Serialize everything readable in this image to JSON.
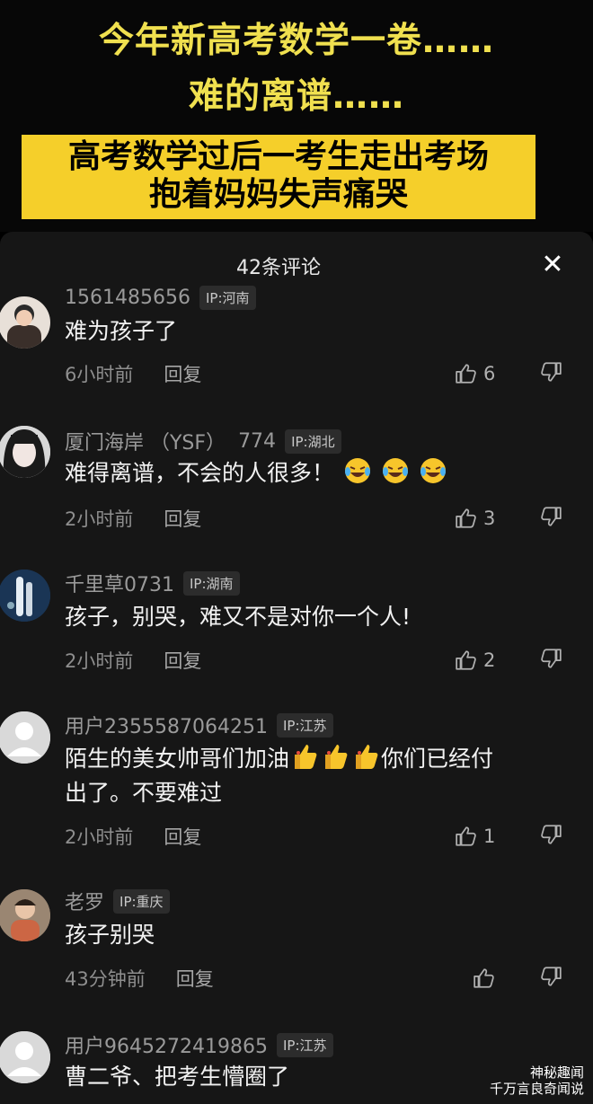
{
  "video": {
    "headline_line1": "今年新高考数学一卷……",
    "headline_line2": "难的离谱……",
    "banner_line1": "高考数学过后一考生走出考场",
    "banner_line2": "抱着妈妈失声痛哭"
  },
  "panel": {
    "title": "42条评论",
    "close_icon": "close-icon"
  },
  "reply_label": "回复",
  "comments": [
    {
      "user": "1561485656",
      "score": "",
      "ip": "IP:河南",
      "text": "难为孩子了",
      "time": "6小时前",
      "likes": "6",
      "emoji_count": 0,
      "thumbs_count": 0,
      "suffix": ""
    },
    {
      "user": "厦门海岸 （YSF）",
      "score": "774",
      "ip": "IP:湖北",
      "text": "难得离谱，不会的人很多！",
      "time": "2小时前",
      "likes": "3",
      "emoji_count": 3,
      "thumbs_count": 0,
      "suffix": ""
    },
    {
      "user": "千里草0731",
      "score": "",
      "ip": "IP:湖南",
      "text": "孩子，别哭，难又不是对你一个人!",
      "time": "2小时前",
      "likes": "2",
      "emoji_count": 0,
      "thumbs_count": 0,
      "suffix": ""
    },
    {
      "user": "用户2355587064251",
      "score": "",
      "ip": "IP:江苏",
      "text": "陌生的美女帅哥们加油",
      "text_suffix": "你们已经付",
      "text_line2": "出了。不要难过",
      "time": "2小时前",
      "likes": "1",
      "emoji_count": 0,
      "thumbs_count": 3
    },
    {
      "user": "老罗",
      "score": "",
      "ip": "IP:重庆",
      "text": "孩子别哭",
      "time": "43分钟前",
      "likes": "",
      "emoji_count": 0,
      "thumbs_count": 0,
      "suffix": ""
    },
    {
      "user": "用户9645272419865",
      "score": "",
      "ip": "IP:江苏",
      "text": "曹二爷、把考生懵圈了",
      "time": "",
      "likes": "",
      "emoji_count": 0,
      "thumbs_count": 0,
      "suffix": ""
    }
  ],
  "watermark": {
    "line1": "神秘趣闻",
    "line2": "千万言良奇闻说"
  },
  "colors": {
    "banner": "#f5cf2a",
    "headline": "#f0e04f",
    "panel": "#161616"
  }
}
